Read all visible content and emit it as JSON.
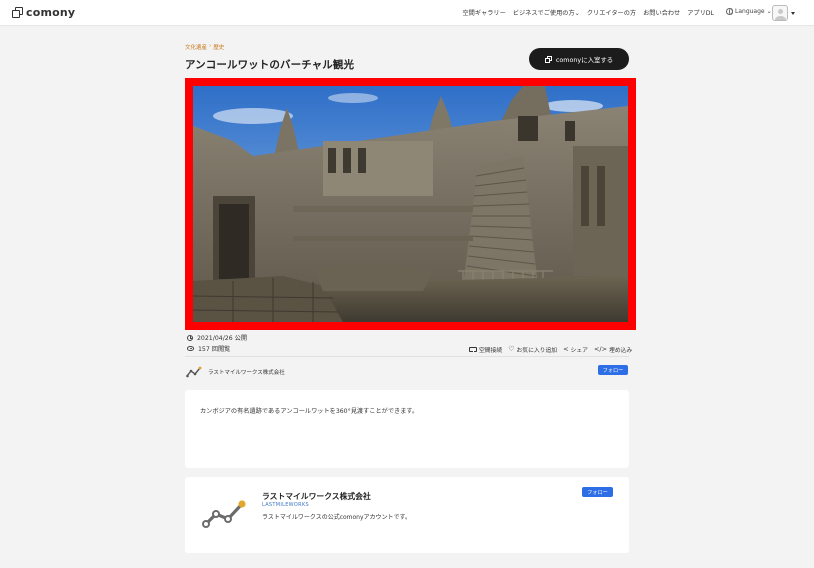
{
  "header": {
    "logo_text": "comony",
    "nav": [
      {
        "label": "空間ギャラリー"
      },
      {
        "label": "ビジネスでご使用の方",
        "caret": "⌄"
      },
      {
        "label": "クリエイターの方"
      },
      {
        "label": "お問い合わせ"
      },
      {
        "label": "アプリDL"
      }
    ],
    "language_label": "Language",
    "language_caret": "⌄"
  },
  "space": {
    "breadcrumb": [
      "文化遺産",
      "›",
      "歴史"
    ],
    "title": "アンコールワットのバーチャル観光",
    "enter_label": "comonyに入室する",
    "published": "2021/04/26 公開",
    "views": "157 回閲覧",
    "actions": {
      "vr": "空間接続",
      "favorite": "お気に入り追加",
      "share": "シェア",
      "embed": "埋め込み"
    }
  },
  "owner": {
    "name": "ラストマイルワークス株式会社",
    "follow_label": "フォロー"
  },
  "description": "カンボジアの有名遺跡であるアンコールワットを360°見渡すことができます。",
  "organization": {
    "name": "ラストマイルワークス株式会社",
    "id": "LASTMILEWORKS",
    "bio": "ラストマイルワークスの公式comonyアカウントです。",
    "follow_label": "フォロー"
  },
  "colors": {
    "accent": "#2d6ee6",
    "breadcrumb": "#c77a1c",
    "viewer_border": "#ff0000",
    "button_dark": "#1c1c1c"
  },
  "icons": {
    "logo": "comony-logo-icon",
    "language": "globe-icon",
    "user": "avatar-icon",
    "enter": "window-icon",
    "published": "clock-icon",
    "views": "eye-icon",
    "vr": "vr-goggles-icon",
    "favorite": "heart-icon",
    "share": "share-icon",
    "embed": "code-icon"
  }
}
